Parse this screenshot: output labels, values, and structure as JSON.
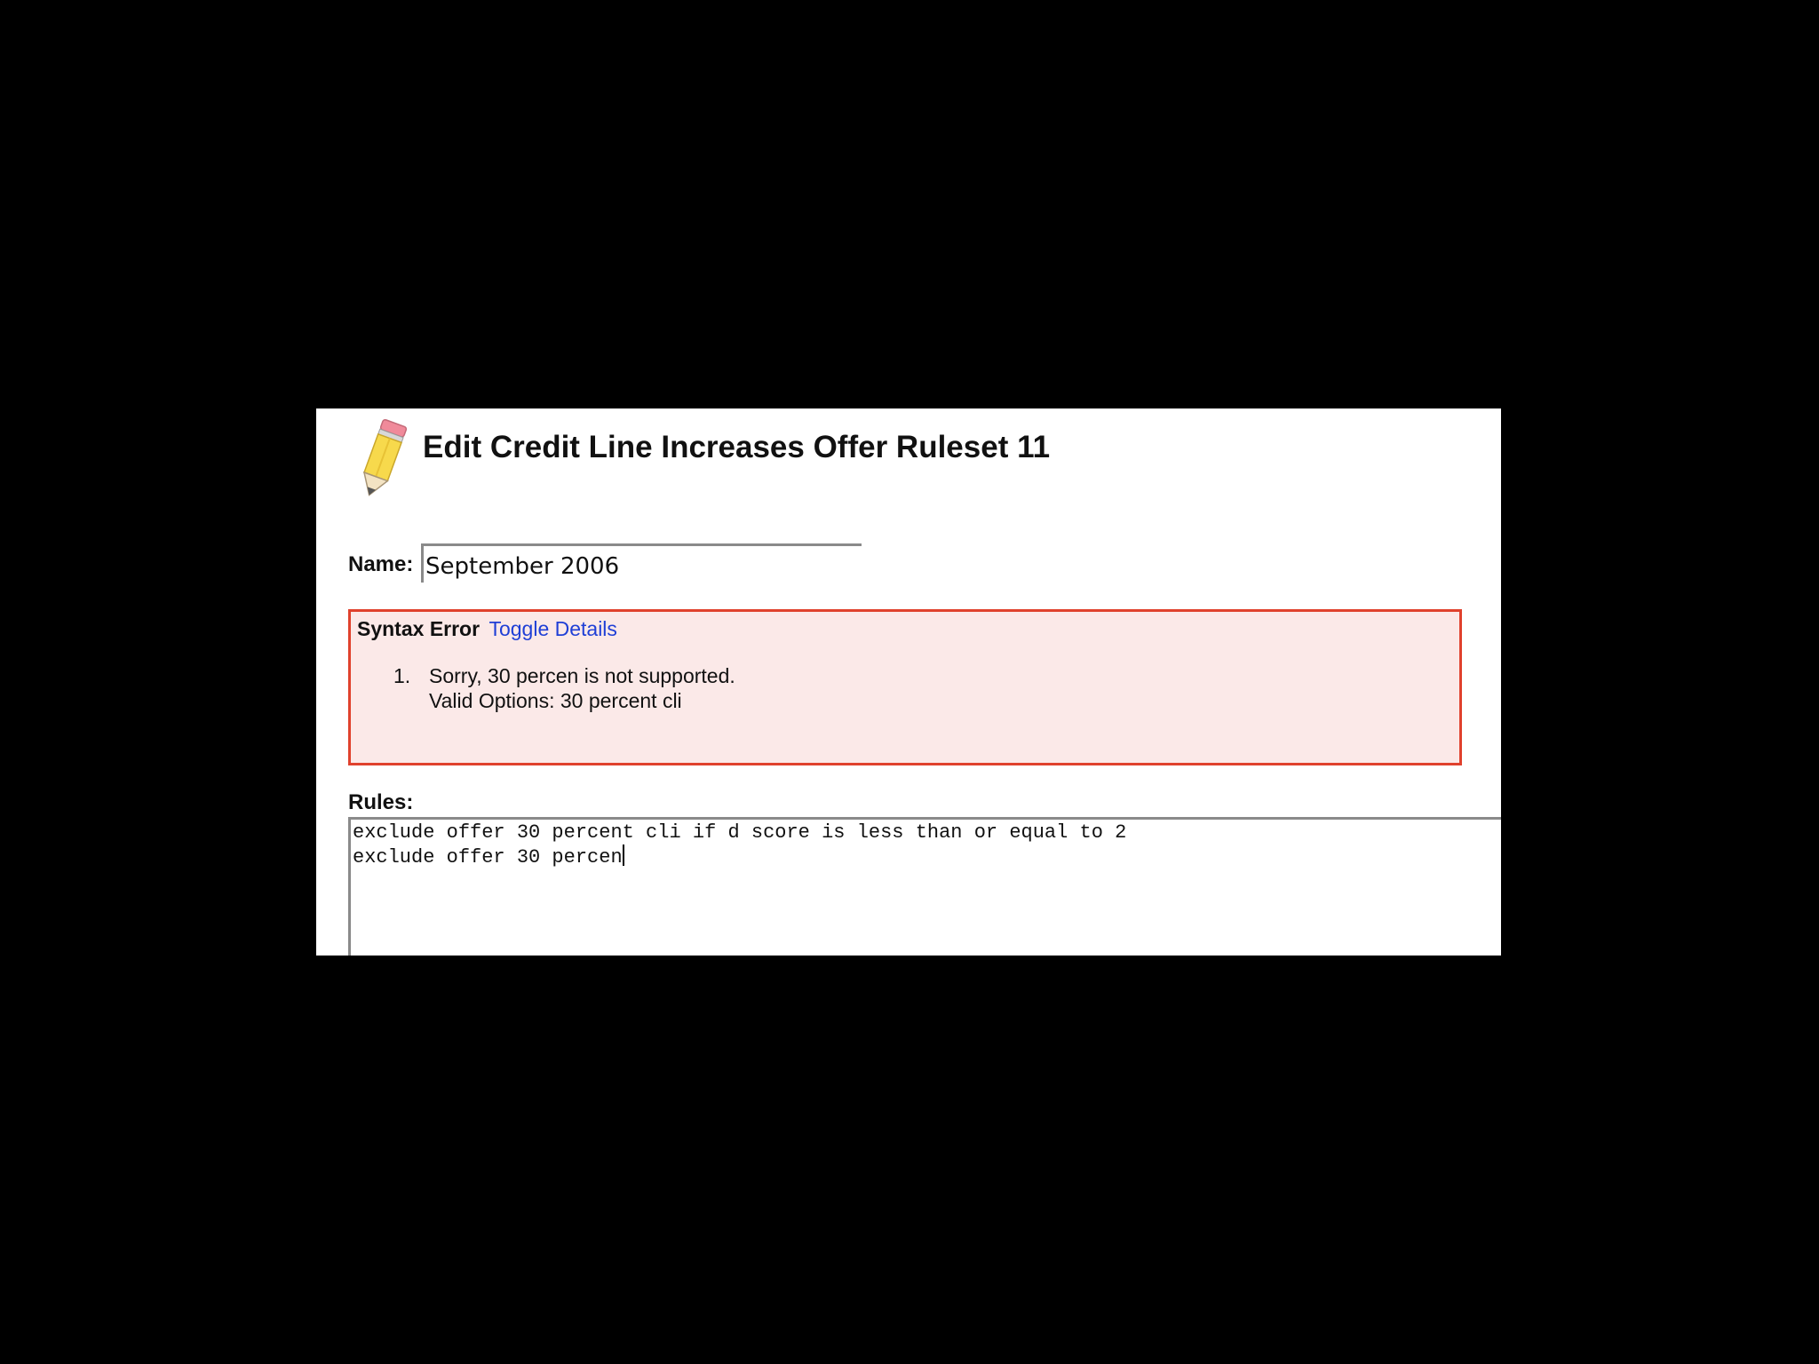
{
  "header": {
    "title": "Edit Credit Line Increases Offer Ruleset 11",
    "icon": "pencil-icon"
  },
  "form": {
    "name_label": "Name:",
    "name_value": "September 2006",
    "rules_label": "Rules:",
    "rules_lines": [
      "exclude offer 30 percent cli if d score is less than or equal to 2",
      "exclude offer 30 percen"
    ]
  },
  "error": {
    "title": "Syntax Error",
    "toggle_label": "Toggle Details",
    "items": [
      {
        "number": "1.",
        "message": "Sorry, 30 percen is not supported.",
        "options": "Valid Options: 30 percent cli"
      }
    ]
  },
  "colors": {
    "background": "#000000",
    "error_border": "#e0412d",
    "error_fill": "#fbe9e8",
    "link": "#1f3fd6"
  }
}
